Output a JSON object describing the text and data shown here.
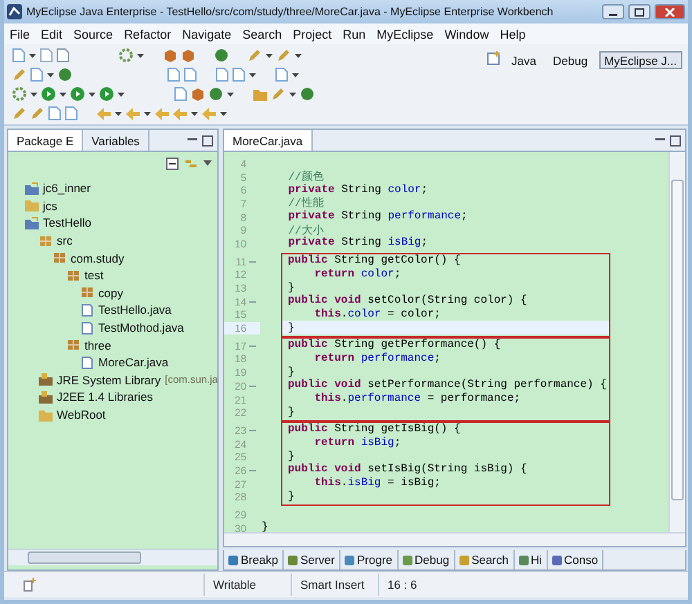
{
  "window": {
    "title": "MyEclipse Java Enterprise - TestHello/src/com/study/three/MoreCar.java - MyEclipse Enterprise Workbench"
  },
  "menu": [
    "File",
    "Edit",
    "Source",
    "Refactor",
    "Navigate",
    "Search",
    "Project",
    "Run",
    "MyEclipse",
    "Window",
    "Help"
  ],
  "perspectives": [
    {
      "label": "Java",
      "selected": false
    },
    {
      "label": "Debug",
      "selected": false
    },
    {
      "label": "MyEclipse J...",
      "selected": true
    }
  ],
  "left_tabs": [
    {
      "label": "Package E",
      "selected": true
    },
    {
      "label": "Variables",
      "selected": false
    }
  ],
  "tree": [
    {
      "label": "jc6_inner",
      "kind": "project"
    },
    {
      "label": "jcs",
      "kind": "folder"
    },
    {
      "label": "TestHello",
      "kind": "project",
      "children": [
        {
          "label": "src",
          "kind": "source",
          "children": [
            {
              "label": "com.study",
              "kind": "package",
              "children": [
                {
                  "label": "test",
                  "kind": "package",
                  "children": [
                    {
                      "label": "copy",
                      "kind": "package"
                    },
                    {
                      "label": "TestHello.java",
                      "kind": "java"
                    },
                    {
                      "label": "TestMothod.java",
                      "kind": "java"
                    }
                  ]
                },
                {
                  "label": "three",
                  "kind": "package",
                  "children": [
                    {
                      "label": "MoreCar.java",
                      "kind": "java"
                    }
                  ]
                }
              ]
            }
          ]
        },
        {
          "label": "JRE System Library",
          "note": "[com.sun.ja",
          "kind": "library"
        },
        {
          "label": "J2EE 1.4 Libraries",
          "kind": "library"
        },
        {
          "label": "WebRoot",
          "kind": "folder"
        }
      ]
    }
  ],
  "editor": {
    "tab": "MoreCar.java",
    "blocks": [
      {
        "boxed": false,
        "lines": [
          {
            "n": "4",
            "fold": false,
            "current": false
          },
          {
            "n": "5",
            "fold": false,
            "current": false,
            "tokens": [
              {
                "kind": "comment",
                "text": "    //颜色"
              }
            ]
          },
          {
            "n": "6",
            "fold": false,
            "current": false,
            "tokens": [
              {
                "kind": "kw",
                "text": "    private "
              },
              {
                "kind": "plain",
                "text": "String "
              },
              {
                "kind": "field",
                "text": "color"
              },
              {
                "kind": "plain",
                "text": ";"
              }
            ]
          },
          {
            "n": "7",
            "fold": false,
            "current": false,
            "tokens": [
              {
                "kind": "comment",
                "text": "    //性能"
              }
            ]
          },
          {
            "n": "8",
            "fold": false,
            "current": false,
            "tokens": [
              {
                "kind": "kw",
                "text": "    private "
              },
              {
                "kind": "plain",
                "text": "String "
              },
              {
                "kind": "field",
                "text": "performance"
              },
              {
                "kind": "plain",
                "text": ";"
              }
            ]
          },
          {
            "n": "9",
            "fold": false,
            "current": false,
            "tokens": [
              {
                "kind": "comment",
                "text": "    //大小"
              }
            ]
          },
          {
            "n": "10",
            "fold": false,
            "current": false,
            "tokens": [
              {
                "kind": "kw",
                "text": "    private "
              },
              {
                "kind": "plain",
                "text": "String "
              },
              {
                "kind": "field",
                "text": "isBig"
              },
              {
                "kind": "plain",
                "text": ";"
              }
            ]
          }
        ]
      },
      {
        "boxed": true,
        "lines": [
          {
            "n": "11",
            "fold": true,
            "current": false,
            "tokens": [
              {
                "kind": "kw",
                "text": "public "
              },
              {
                "kind": "plain",
                "text": "String getColor() {"
              }
            ]
          },
          {
            "n": "12",
            "fold": false,
            "current": false,
            "tokens": [
              {
                "kind": "kw",
                "text": "    return "
              },
              {
                "kind": "field",
                "text": "color"
              },
              {
                "kind": "plain",
                "text": ";"
              }
            ]
          },
          {
            "n": "13",
            "fold": false,
            "current": false,
            "tokens": [
              {
                "kind": "plain",
                "text": "}"
              }
            ]
          },
          {
            "n": "14",
            "fold": true,
            "current": false,
            "tokens": [
              {
                "kind": "kw",
                "text": "public void "
              },
              {
                "kind": "plain",
                "text": "setColor(String color) {"
              }
            ]
          },
          {
            "n": "15",
            "fold": false,
            "current": false,
            "tokens": [
              {
                "kind": "kw",
                "text": "    this"
              },
              {
                "kind": "plain",
                "text": "."
              },
              {
                "kind": "field",
                "text": "color"
              },
              {
                "kind": "plain",
                "text": " = color;"
              }
            ]
          },
          {
            "n": "16",
            "fold": false,
            "current": true,
            "tokens": [
              {
                "kind": "plain",
                "text": "}"
              }
            ]
          }
        ]
      },
      {
        "boxed": true,
        "lines": [
          {
            "n": "17",
            "fold": true,
            "current": false,
            "tokens": [
              {
                "kind": "kw",
                "text": "public "
              },
              {
                "kind": "plain",
                "text": "String getPerformance() {"
              }
            ]
          },
          {
            "n": "18",
            "fold": false,
            "current": false,
            "tokens": [
              {
                "kind": "kw",
                "text": "    return "
              },
              {
                "kind": "field",
                "text": "performance"
              },
              {
                "kind": "plain",
                "text": ";"
              }
            ]
          },
          {
            "n": "19",
            "fold": false,
            "current": false,
            "tokens": [
              {
                "kind": "plain",
                "text": "}"
              }
            ]
          },
          {
            "n": "20",
            "fold": true,
            "current": false,
            "tokens": [
              {
                "kind": "kw",
                "text": "public void "
              },
              {
                "kind": "plain",
                "text": "setPerformance(String performance) {"
              }
            ]
          },
          {
            "n": "21",
            "fold": false,
            "current": false,
            "tokens": [
              {
                "kind": "kw",
                "text": "    this"
              },
              {
                "kind": "plain",
                "text": "."
              },
              {
                "kind": "field",
                "text": "performance"
              },
              {
                "kind": "plain",
                "text": " = performance;"
              }
            ]
          },
          {
            "n": "22",
            "fold": false,
            "current": false,
            "tokens": [
              {
                "kind": "plain",
                "text": "}"
              }
            ]
          }
        ]
      },
      {
        "boxed": true,
        "lines": [
          {
            "n": "23",
            "fold": true,
            "current": false,
            "tokens": [
              {
                "kind": "kw",
                "text": "public "
              },
              {
                "kind": "plain",
                "text": "String getIsBig() {"
              }
            ]
          },
          {
            "n": "24",
            "fold": false,
            "current": false,
            "tokens": [
              {
                "kind": "kw",
                "text": "    return "
              },
              {
                "kind": "field",
                "text": "isBig"
              },
              {
                "kind": "plain",
                "text": ";"
              }
            ]
          },
          {
            "n": "25",
            "fold": false,
            "current": false,
            "tokens": [
              {
                "kind": "plain",
                "text": "}"
              }
            ]
          },
          {
            "n": "26",
            "fold": true,
            "current": false,
            "tokens": [
              {
                "kind": "kw",
                "text": "public void "
              },
              {
                "kind": "plain",
                "text": "setIsBig(String isBig) {"
              }
            ]
          },
          {
            "n": "27",
            "fold": false,
            "current": false,
            "tokens": [
              {
                "kind": "kw",
                "text": "    this"
              },
              {
                "kind": "plain",
                "text": "."
              },
              {
                "kind": "field",
                "text": "isBig"
              },
              {
                "kind": "plain",
                "text": " = isBig;"
              }
            ]
          },
          {
            "n": "28",
            "fold": false,
            "current": false,
            "tokens": [
              {
                "kind": "plain",
                "text": "}"
              }
            ]
          }
        ]
      },
      {
        "boxed": false,
        "lines": [
          {
            "n": "29",
            "fold": false,
            "current": false
          },
          {
            "n": "30",
            "fold": false,
            "current": false,
            "tokens": [
              {
                "kind": "plain",
                "text": "}"
              }
            ]
          }
        ]
      }
    ]
  },
  "bottom_tabs": [
    {
      "label": "Breakp",
      "selected": false
    },
    {
      "label": "Server",
      "selected": false
    },
    {
      "label": "Progre",
      "selected": false
    },
    {
      "label": "Debug",
      "selected": false
    },
    {
      "label": "Search",
      "selected": false
    },
    {
      "label": "Hi",
      "selected": false
    },
    {
      "label": "Conso",
      "selected": false
    }
  ],
  "status_bar": {
    "state": "Writable",
    "mode": "Smart Insert",
    "position": "16 : 6"
  }
}
